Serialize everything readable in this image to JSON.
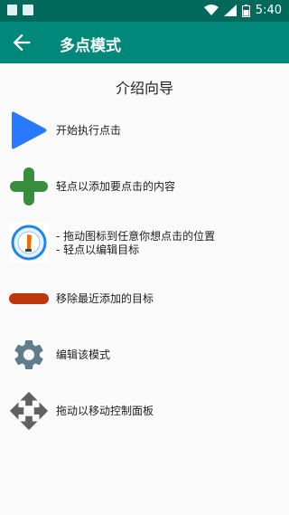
{
  "status_bar": {
    "time": "5:40",
    "icons": [
      "wifi-icon",
      "signal-icon",
      "battery-icon"
    ]
  },
  "app_bar": {
    "title": "多点模式",
    "back_icon": "arrow-back-icon"
  },
  "content": {
    "title": "介绍向导",
    "items": [
      {
        "icon": "play-triangle-icon",
        "label_lines": [
          "开始执行点击"
        ]
      },
      {
        "icon": "plus-icon",
        "label_lines": [
          "轻点以添加要点击的内容"
        ]
      },
      {
        "icon": "target-marker-icon",
        "label_lines": [
          "- 拖动图标到任意你想点击的位置",
          "- 轻点以编辑目标"
        ]
      },
      {
        "icon": "remove-bar-icon",
        "label_lines": [
          "移除最近添加的目标"
        ]
      },
      {
        "icon": "gear-icon",
        "label_lines": [
          "编辑该模式"
        ]
      },
      {
        "icon": "move-arrows-icon",
        "label_lines": [
          "拖动以移动控制面板"
        ]
      }
    ]
  },
  "colors": {
    "status_bar": "#00695c",
    "app_bar": "#00897b",
    "play": "#2979ff",
    "plus": "#388e3c",
    "remove": "#bf360c",
    "gear": "#607d8b",
    "move": "#616161"
  }
}
